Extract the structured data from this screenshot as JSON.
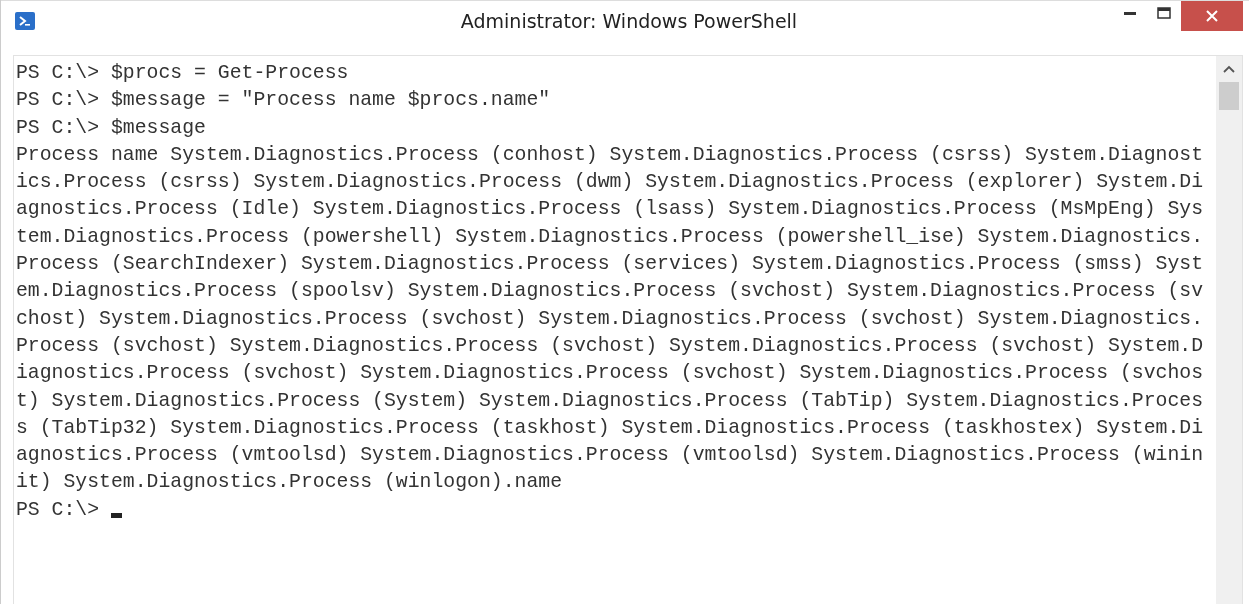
{
  "window": {
    "title": "Administrator: Windows PowerShell"
  },
  "console": {
    "lines": [
      "PS C:\\> $procs = Get-Process",
      "PS C:\\> $message = \"Process name $procs.name\"",
      "PS C:\\> $message",
      "Process name System.Diagnostics.Process (conhost) System.Diagnostics.Process (csrss) System.Diagnost",
      "ics.Process (csrss) System.Diagnostics.Process (dwm) System.Diagnostics.Process (explorer) System.Di",
      "agnostics.Process (Idle) System.Diagnostics.Process (lsass) System.Diagnostics.Process (MsMpEng) Sys",
      "tem.Diagnostics.Process (powershell) System.Diagnostics.Process (powershell_ise) System.Diagnostics.",
      "Process (SearchIndexer) System.Diagnostics.Process (services) System.Diagnostics.Process (smss) Syst",
      "em.Diagnostics.Process (spoolsv) System.Diagnostics.Process (svchost) System.Diagnostics.Process (sv",
      "chost) System.Diagnostics.Process (svchost) System.Diagnostics.Process (svchost) System.Diagnostics.",
      "Process (svchost) System.Diagnostics.Process (svchost) System.Diagnostics.Process (svchost) System.D",
      "iagnostics.Process (svchost) System.Diagnostics.Process (svchost) System.Diagnostics.Process (svchos",
      "t) System.Diagnostics.Process (System) System.Diagnostics.Process (TabTip) System.Diagnostics.Proces",
      "s (TabTip32) System.Diagnostics.Process (taskhost) System.Diagnostics.Process (taskhostex) System.Di",
      "agnostics.Process (vmtoolsd) System.Diagnostics.Process (vmtoolsd) System.Diagnostics.Process (winin",
      "it) System.Diagnostics.Process (winlogon).name"
    ],
    "prompt": "PS C:\\>"
  }
}
